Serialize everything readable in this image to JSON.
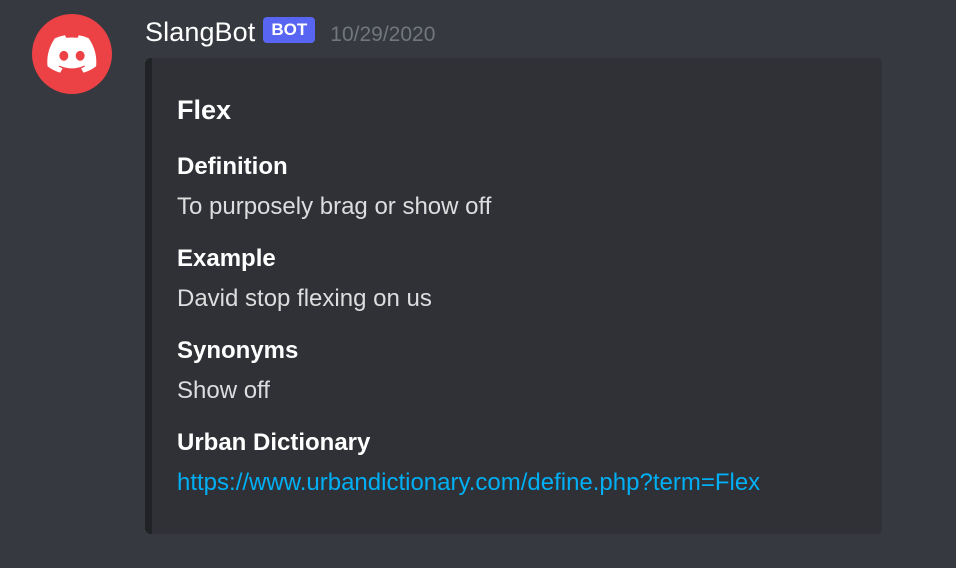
{
  "message": {
    "username": "SlangBot",
    "badge": "BOT",
    "timestamp": "10/29/2020",
    "avatar_icon": "discord-logo-icon",
    "avatar_color": "#ed4245"
  },
  "embed": {
    "title": "Flex",
    "fields": [
      {
        "name": "Definition",
        "value": "To purposely brag or show off"
      },
      {
        "name": "Example",
        "value": "David stop flexing on us"
      },
      {
        "name": "Synonyms",
        "value": "Show off"
      },
      {
        "name": "Urban Dictionary",
        "value": "https://www.urbandictionary.com/define.php?term=Flex"
      }
    ]
  },
  "colors": {
    "background": "#36393f",
    "embed_background": "#2f3136",
    "link": "#00aff4",
    "badge": "#5865f2"
  }
}
